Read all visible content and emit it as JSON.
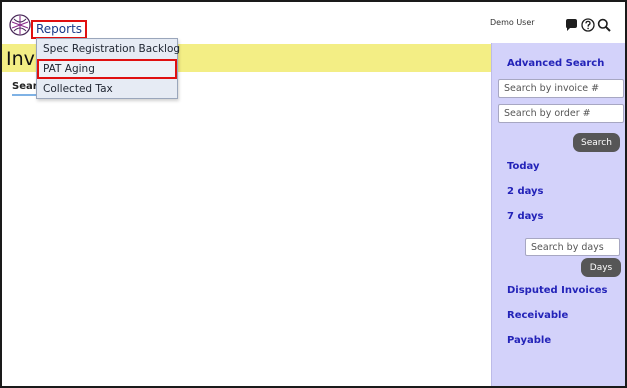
{
  "header": {
    "reports_label": "Reports",
    "user_name": "Demo User"
  },
  "page": {
    "title": "Invoices",
    "search_tab": "Search"
  },
  "reports_menu": {
    "items": [
      {
        "label": "Spec Registration Backlog"
      },
      {
        "label": "PAT Aging"
      },
      {
        "label": "Collected Tax"
      }
    ]
  },
  "sidebar": {
    "heading": "Advanced Search",
    "invoice_placeholder": "Search by invoice #",
    "order_placeholder": "Search by order #",
    "search_button": "Search",
    "links": {
      "today": "Today",
      "two_days": "2 days",
      "seven_days": "7 days"
    },
    "days_placeholder": "Search by days",
    "days_button": "Days",
    "disputed": "Disputed Invoices",
    "receivable": "Receivable",
    "payable": "Payable"
  },
  "colors": {
    "title_band": "#f3ee85",
    "sidebar_bg": "#d3d2fa",
    "link": "#2323b8",
    "highlight_border": "#e01010",
    "button_bg": "#565656"
  }
}
